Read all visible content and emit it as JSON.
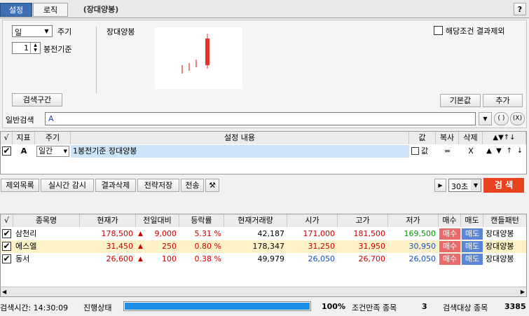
{
  "tabs": {
    "setting": "설정",
    "logic": "로직",
    "condition_title": "(장대양봉)",
    "help": "?"
  },
  "period": {
    "unit_value": "일",
    "unit_label": "주기",
    "bar_value": "1",
    "bar_label": "봉전기준"
  },
  "condition_name": "장대양봉",
  "exclude_label": "해당조건 결과제외",
  "buttons": {
    "search_range": "검색구간",
    "default": "기본값",
    "add": "추가"
  },
  "general_search": {
    "label": "일반검색",
    "value": "A"
  },
  "paren_btn": "( )",
  "x_btn": "(X)",
  "cond_table": {
    "headers": [
      "√",
      "지표",
      "주기",
      "설정 내용",
      "값",
      "복사",
      "삭제",
      "▲▼↑↓"
    ],
    "row": {
      "indicator": "A",
      "period": "일간",
      "content": "1봉전기준 장대양봉",
      "value_label": "값",
      "copy": "=",
      "delete": "X",
      "arrows": [
        "▲",
        "▼",
        "↑",
        "↓"
      ]
    }
  },
  "toolbar": {
    "items": [
      "제외목록",
      "실시간 감시",
      "결과삭제",
      "전략저장",
      "전송"
    ],
    "interval": "30초",
    "search": "검 색"
  },
  "result_table": {
    "headers": [
      "√",
      "종목명",
      "현재가",
      "전일대비",
      "등락률",
      "현재거래량",
      "시가",
      "고가",
      "저가",
      "매수",
      "매도",
      "캔들패턴"
    ],
    "rows": [
      {
        "name": "삼천리",
        "price": "178,500",
        "diff": "9,000",
        "rate": "5.31 %",
        "volume": "42,187",
        "open": "171,000",
        "high": "181,500",
        "low": "169,500",
        "buy": "매수",
        "sell": "매도",
        "pattern": "장대양봉"
      },
      {
        "name": "에스엘",
        "price": "31,450",
        "diff": "250",
        "rate": "0.80 %",
        "volume": "178,347",
        "open": "31,250",
        "high": "31,950",
        "low": "30,950",
        "buy": "매수",
        "sell": "매도",
        "pattern": "장대양봉"
      },
      {
        "name": "동서",
        "price": "26,600",
        "diff": "100",
        "rate": "0.38 %",
        "volume": "49,979",
        "open": "26,050",
        "high": "26,700",
        "low": "26,050",
        "buy": "매수",
        "sell": "매도",
        "pattern": "장대양봉"
      }
    ]
  },
  "status": {
    "time_label": "검색시간: 14:30:09",
    "progress_label": "진행상태",
    "progress_pct": "100%",
    "progress": 1.0,
    "match_label": "조건만족 종목",
    "match_count": "3",
    "target_label": "검색대상 종목",
    "target_count": "3385"
  },
  "colors": {
    "accent_red": "#e8421e",
    "buy_bg": "#e86a6a",
    "sell_bg": "#5b86d6",
    "highlight_row": "#fdf1c8",
    "progress_blue": "#1e8ee6"
  }
}
